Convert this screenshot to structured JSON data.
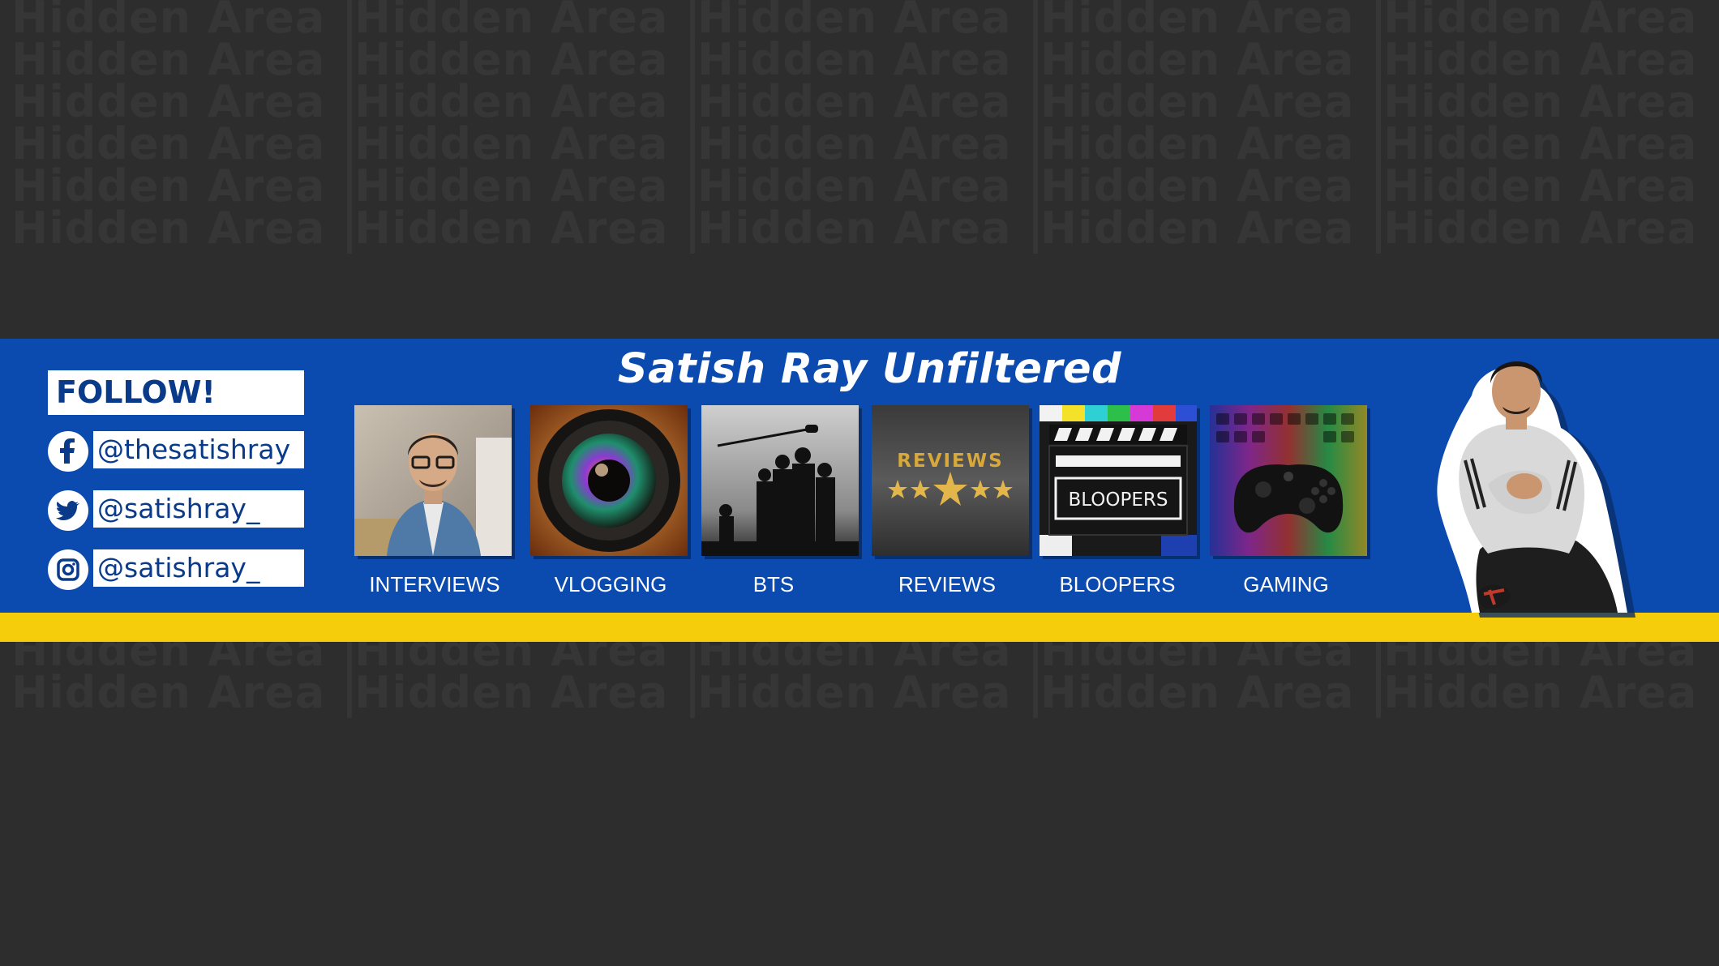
{
  "background": {
    "watermark_text": "Hidden Area",
    "color": "#2d2d2d"
  },
  "banner": {
    "title": "Satish Ray Unfiltered",
    "band_color": "#0b4aae",
    "stripe_color": "#f5cd0a"
  },
  "follow": {
    "label": "FOLLOW!",
    "socials": [
      {
        "icon": "facebook-icon",
        "handle": "@thesatishray"
      },
      {
        "icon": "twitter-icon",
        "handle": "@satishray_"
      },
      {
        "icon": "instagram-icon",
        "handle": "@satishray_"
      }
    ]
  },
  "categories": [
    {
      "label": "INTERVIEWS",
      "image": "man-in-denim-shirt-photo"
    },
    {
      "label": "VLOGGING",
      "image": "camera-lens-photo"
    },
    {
      "label": "BTS",
      "image": "film-crew-silhouette-photo"
    },
    {
      "label": "REVIEWS",
      "image": "reviews-stars-graphic",
      "inner_text": "REVIEWS"
    },
    {
      "label": "BLOOPERS",
      "image": "clapperboard-graphic",
      "inner_text": "BLOOPERS"
    },
    {
      "label": "GAMING",
      "image": "game-controller-photo"
    }
  ]
}
